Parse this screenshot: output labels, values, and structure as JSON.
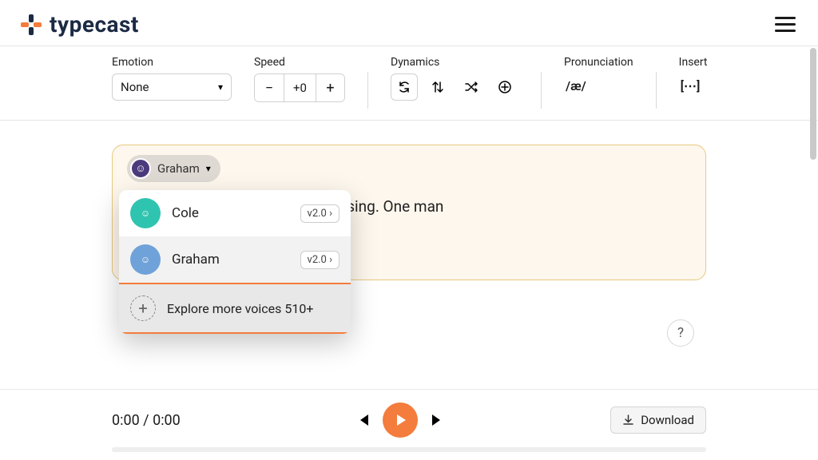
{
  "brand": {
    "name": "typecast"
  },
  "toolbar": {
    "emotion": {
      "label": "Emotion",
      "value": "None"
    },
    "speed": {
      "label": "Speed",
      "value": "+0"
    },
    "dynamics": {
      "label": "Dynamics"
    },
    "pronunciation": {
      "label": "Pronunciation",
      "symbol": "/æ/"
    },
    "insert": {
      "label": "Insert",
      "symbol": "[⋯]"
    }
  },
  "script": {
    "current_character": "Graham",
    "text": "ever shines, and the birds never sing. One man"
  },
  "voice_picker": {
    "items": [
      {
        "name": "Cole",
        "version": "v2.0",
        "avatar_bg": "#2fc4b0"
      },
      {
        "name": "Graham",
        "version": "v2.0",
        "avatar_bg": "#6fa2d8",
        "selected": true
      }
    ],
    "explore_label": "Explore more voices 510+"
  },
  "player": {
    "time_current": "0:00",
    "time_total": "0:00",
    "download_label": "Download"
  }
}
